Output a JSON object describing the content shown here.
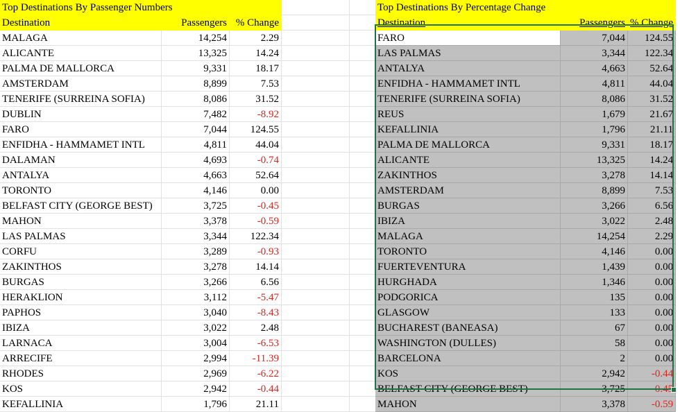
{
  "left": {
    "title": "Top Destinations By Passenger Numbers",
    "headers": [
      "Destination",
      "Passengers",
      "% Change"
    ],
    "rows": [
      [
        "MALAGA",
        "14,254",
        "2.29"
      ],
      [
        "ALICANTE",
        "13,325",
        "14.24"
      ],
      [
        "PALMA DE MALLORCA",
        "9,331",
        "18.17"
      ],
      [
        "AMSTERDAM",
        "8,899",
        "7.53"
      ],
      [
        "TENERIFE (SURREINA SOFIA)",
        "8,086",
        "31.52"
      ],
      [
        "DUBLIN",
        "7,482",
        "-8.92"
      ],
      [
        "FARO",
        "7,044",
        "124.55"
      ],
      [
        "ENFIDHA - HAMMAMET INTL",
        "4,811",
        "44.04"
      ],
      [
        "DALAMAN",
        "4,693",
        "-0.74"
      ],
      [
        "ANTALYA",
        "4,663",
        "52.64"
      ],
      [
        "TORONTO",
        "4,146",
        "0.00"
      ],
      [
        "BELFAST CITY (GEORGE BEST)",
        "3,725",
        "-0.45"
      ],
      [
        "MAHON",
        "3,378",
        "-0.59"
      ],
      [
        "LAS PALMAS",
        "3,344",
        "122.34"
      ],
      [
        "CORFU",
        "3,289",
        "-0.93"
      ],
      [
        "ZAKINTHOS",
        "3,278",
        "14.14"
      ],
      [
        "BURGAS",
        "3,266",
        "6.56"
      ],
      [
        "HERAKLION",
        "3,112",
        "-5.47"
      ],
      [
        "PAPHOS",
        "3,040",
        "-8.43"
      ],
      [
        "IBIZA",
        "3,022",
        "2.48"
      ],
      [
        "LARNACA",
        "3,004",
        "-6.53"
      ],
      [
        "ARRECIFE",
        "2,994",
        "-11.39"
      ],
      [
        "RHODES",
        "2,969",
        "-6.22"
      ],
      [
        "KOS",
        "2,942",
        "-0.44"
      ],
      [
        "KEFALLINIA",
        "1,796",
        "21.11"
      ]
    ]
  },
  "right": {
    "title": "Top Destinations By Percentage Change",
    "headers": [
      "Destination",
      "Passengers",
      "% Change"
    ],
    "rows": [
      [
        "FARO",
        "7,044",
        "124.55"
      ],
      [
        "LAS PALMAS",
        "3,344",
        "122.34"
      ],
      [
        "ANTALYA",
        "4,663",
        "52.64"
      ],
      [
        "ENFIDHA - HAMMAMET INTL",
        "4,811",
        "44.04"
      ],
      [
        "TENERIFE (SURREINA SOFIA)",
        "8,086",
        "31.52"
      ],
      [
        "REUS",
        "1,679",
        "21.67"
      ],
      [
        "KEFALLINIA",
        "1,796",
        "21.11"
      ],
      [
        "PALMA DE MALLORCA",
        "9,331",
        "18.17"
      ],
      [
        "ALICANTE",
        "13,325",
        "14.24"
      ],
      [
        "ZAKINTHOS",
        "3,278",
        "14.14"
      ],
      [
        "AMSTERDAM",
        "8,899",
        "7.53"
      ],
      [
        "BURGAS",
        "3,266",
        "6.56"
      ],
      [
        "IBIZA",
        "3,022",
        "2.48"
      ],
      [
        "MALAGA",
        "14,254",
        "2.29"
      ],
      [
        "TORONTO",
        "4,146",
        "0.00"
      ],
      [
        "FUERTEVENTURA",
        "1,439",
        "0.00"
      ],
      [
        "HURGHADA",
        "1,346",
        "0.00"
      ],
      [
        "PODGORICA",
        "135",
        "0.00"
      ],
      [
        "GLASGOW",
        "133",
        "0.00"
      ],
      [
        "BUCHAREST (BANEASA)",
        "67",
        "0.00"
      ],
      [
        "WASHINGTON (DULLES)",
        "58",
        "0.00"
      ],
      [
        "BARCELONA",
        "2",
        "0.00"
      ],
      [
        "KOS",
        "2,942",
        "-0.44"
      ],
      [
        "BELFAST CITY (GEORGE BEST)",
        "3,725",
        "-0.45"
      ],
      [
        "MAHON",
        "3,378",
        "-0.59"
      ]
    ]
  },
  "colors": {
    "header_fill": "#ffff00",
    "selection_fill": "#c0c0c0",
    "selection_border": "#217346",
    "negative_text": "#e32119"
  }
}
